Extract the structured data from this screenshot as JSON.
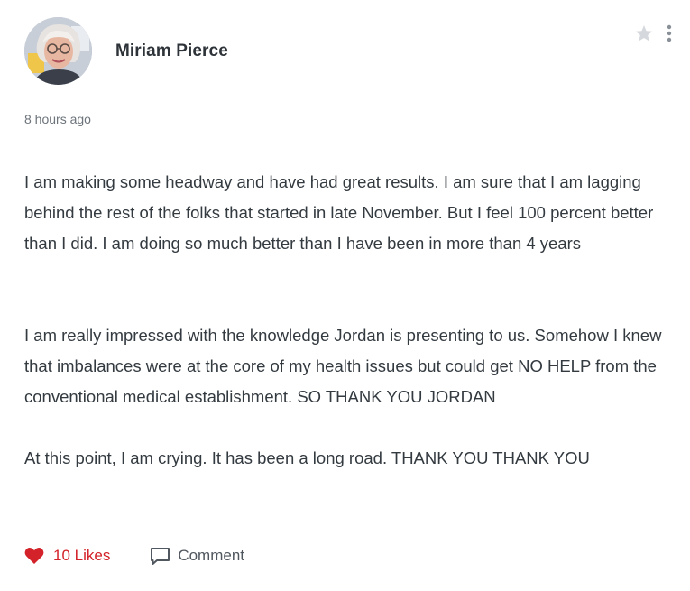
{
  "author": {
    "name": "Miriam Pierce",
    "avatar_icon": "user-photo-avatar"
  },
  "post": {
    "time": "8 hours ago",
    "paragraphs": [
      "I am making some headway and have had great results. I am sure that I am lagging behind the rest of the folks that started in late November. But I feel 100 percent better than I did. I am doing so much better than I have been in more than 4 years",
      "I am really impressed with the knowledge Jordan is presenting to us. Somehow I knew that imbalances were at the core of my health issues but could get NO HELP from the conventional medical establishment. SO THANK YOU JORDAN",
      "At this point, I am crying. It has been a long road. THANK YOU THANK YOU"
    ]
  },
  "header_actions": {
    "star_icon": "star-icon",
    "more_icon": "more-vertical-icon"
  },
  "actions": {
    "likes_label": "10 Likes",
    "comment_label": "Comment",
    "heart_icon": "heart-icon",
    "comment_icon": "comment-icon"
  },
  "colors": {
    "like_red": "#d32229",
    "text": "#333a40",
    "muted": "#6d747b",
    "icon_grey": "#c9ccd0"
  }
}
